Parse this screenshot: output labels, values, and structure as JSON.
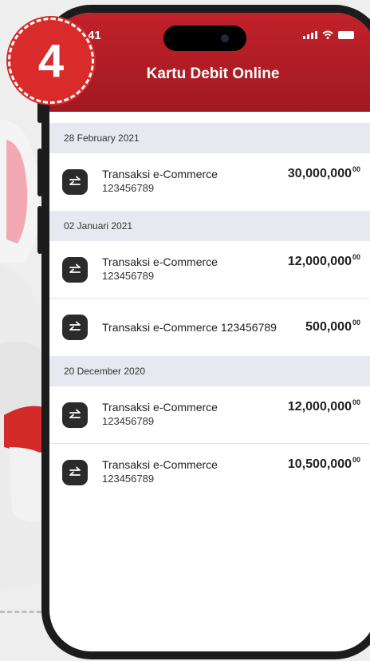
{
  "step": "4",
  "status_bar": {
    "time": "41"
  },
  "header": {
    "title": "Kartu Debit Online"
  },
  "sections": [
    {
      "date": "28 February 2021",
      "items": [
        {
          "name": "Transaksi e-Commerce",
          "id": "123456789",
          "amount": "30,000,000",
          "cents": "00"
        }
      ]
    },
    {
      "date": "02 Januari 2021",
      "items": [
        {
          "name": "Transaksi e-Commerce",
          "id": "123456789",
          "amount": "12,000,000",
          "cents": "00"
        },
        {
          "name": "Transaksi e-Commerce 123456789",
          "amount": "500,000",
          "cents": "00"
        }
      ]
    },
    {
      "date": "20 December 2020",
      "items": [
        {
          "name": "Transaksi e-Commerce",
          "id": "123456789",
          "amount": "12,000,000",
          "cents": "00"
        },
        {
          "name": "Transaksi e-Commerce",
          "id": "123456789",
          "amount": "10,500,000",
          "cents": "00"
        }
      ]
    }
  ]
}
